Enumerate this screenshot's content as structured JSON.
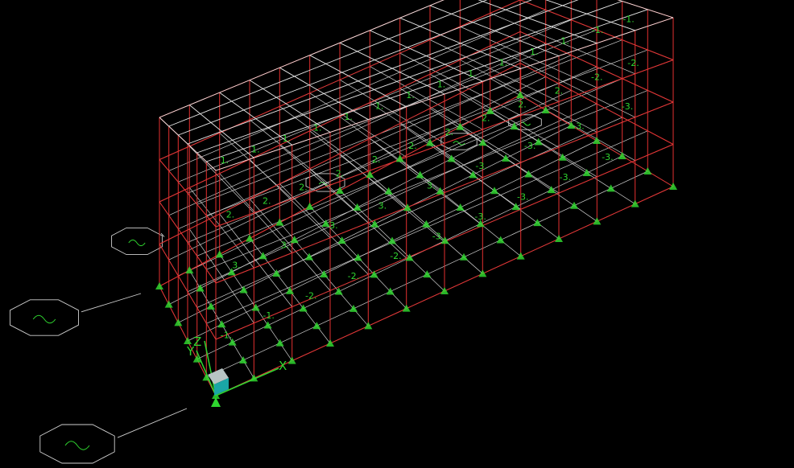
{
  "viewport": {
    "background": "#000000",
    "colors": {
      "roof_grid": "#e8e8e8",
      "frame": "#e53030",
      "slab_grid": "#d0d0d0",
      "labels": "#2fd62f",
      "supports": "#2fd62f",
      "axes": "#2fd62f",
      "cube_top": "#b8c4c4",
      "cube_side": "#1aa6a6",
      "section_cut": "#d0d0d0"
    }
  },
  "axes": {
    "x_label": "X",
    "y_label": "Y",
    "z_label": "Z"
  },
  "model": {
    "bays_long": 12,
    "bays_wide": 6,
    "storeys": 4,
    "level_labels_roof": [
      "1.",
      "1.",
      "1.",
      "1.",
      "1.",
      "1.",
      "1.",
      "1.",
      "1.",
      "1.",
      "1.",
      "1.",
      "-1.",
      "-1."
    ],
    "level_labels_mid": [
      "2.",
      "2.",
      "2.",
      "2.",
      "2.",
      "2.",
      "2.",
      "2.",
      "2.",
      "2.",
      "-2.",
      "-2."
    ],
    "level_labels_low": [
      "3.",
      "3.",
      "3.",
      "3.",
      "3.",
      "-3.",
      "-3.",
      "-3.",
      "-3."
    ],
    "ground_labels": [
      "-1.",
      "-1.",
      "-2.",
      "-2.",
      "-2.",
      "-3.",
      "-3.",
      "-3.",
      "-3.",
      "-3."
    ]
  }
}
